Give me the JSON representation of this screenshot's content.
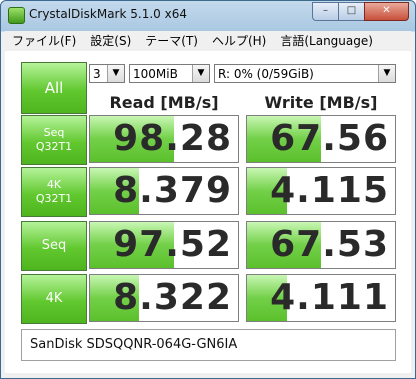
{
  "window": {
    "title": "CrystalDiskMark 5.1.0 x64",
    "buttons": {
      "minimize": "–",
      "maximize": "□",
      "close": "✕"
    }
  },
  "menu": [
    "ファイル(F)",
    "設定(S)",
    "テーマ(T)",
    "ヘルプ(H)",
    "言語(Language)"
  ],
  "toolbar": {
    "all_label": "All",
    "count": "3",
    "size": "100MiB",
    "drive": "R: 0% (0/59GiB)"
  },
  "headers": {
    "read": "Read [MB/s]",
    "write": "Write [MB/s]"
  },
  "rows": [
    {
      "label1": "Seq",
      "label2": "Q32T1",
      "read": "98.28",
      "write": "67.56",
      "read_level": 0.57,
      "write_level": 0.5
    },
    {
      "label1": "4K",
      "label2": "Q32T1",
      "read": "8.379",
      "write": "4.115",
      "read_level": 0.33,
      "write_level": 0.27
    },
    {
      "label1": "Seq",
      "label2": "",
      "read": "97.52",
      "write": "67.53",
      "read_level": 0.57,
      "write_level": 0.5
    },
    {
      "label1": "4K",
      "label2": "",
      "read": "8.322",
      "write": "4.111",
      "read_level": 0.33,
      "write_level": 0.27
    }
  ],
  "comment": "SanDisk SDSQQNR-064G-GN6IA",
  "colors": {
    "accent_green": "#62c830",
    "title_blue": "#aac8e2"
  }
}
